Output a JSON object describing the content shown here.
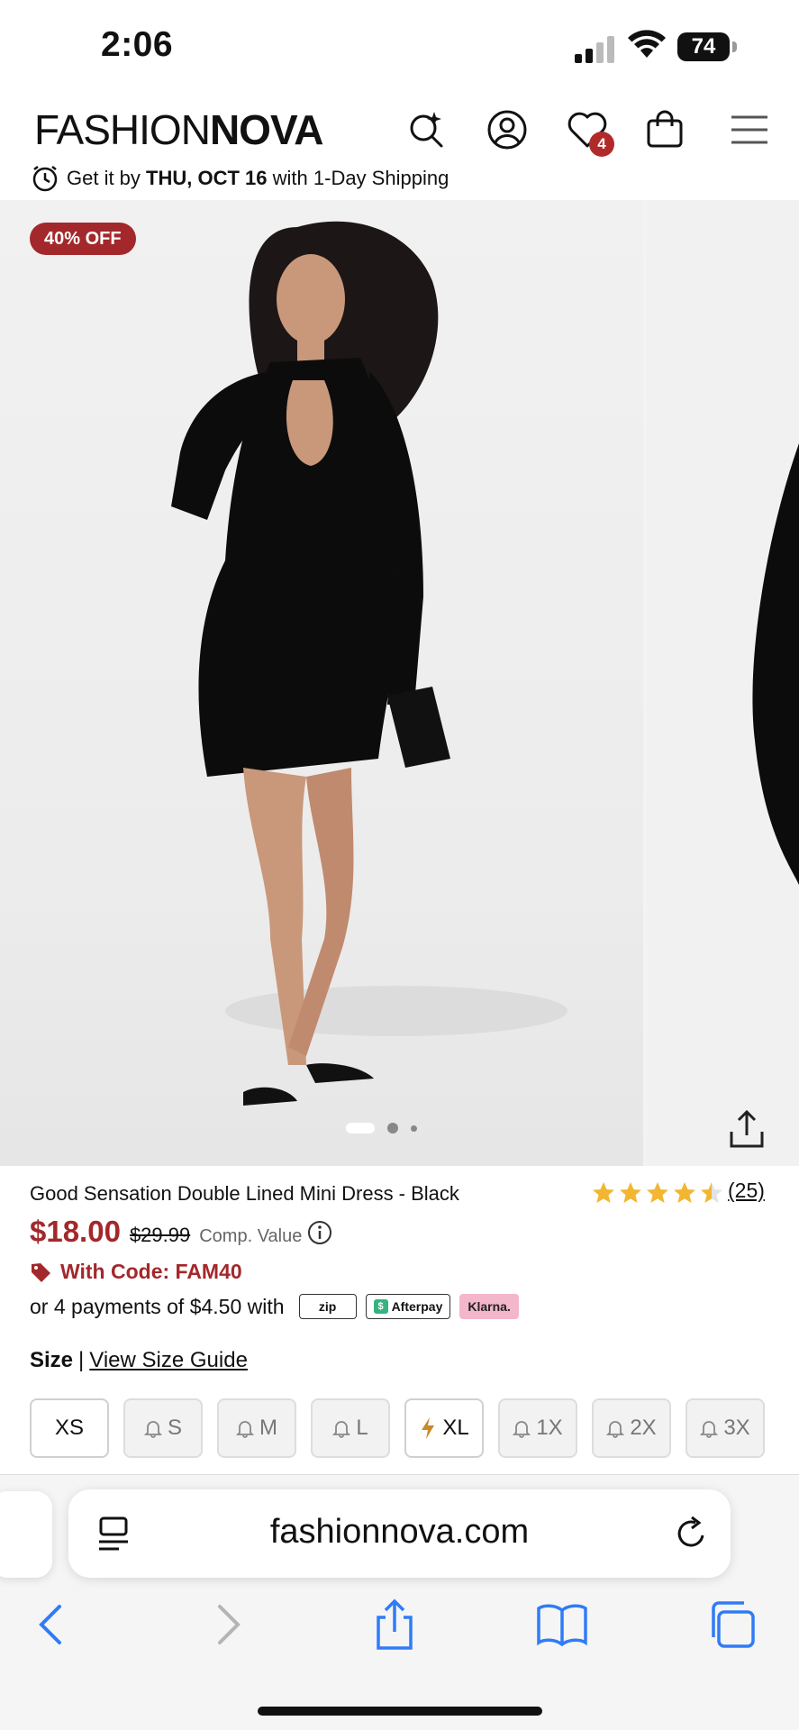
{
  "status_bar": {
    "time": "2:06",
    "battery": "74"
  },
  "header": {
    "logo_left": "FA",
    "logo_mid": "SHION",
    "logo_bold": "NOVA",
    "wishlist_count": "4"
  },
  "shipping": {
    "prefix": "Get it by",
    "date": "THU, OCT 16",
    "suffix": "with 1-Day Shipping"
  },
  "gallery": {
    "badge": "40% OFF"
  },
  "product": {
    "title": "Good Sensation Double Lined Mini Dress - Black",
    "rating": 4.5,
    "reviews": "(25)",
    "price": "$18.00",
    "compare_price": "$29.99",
    "comp_label": "Comp. Value",
    "code_text": "With Code: FAM40",
    "installments": "or 4 payments of $4.50 with",
    "pay_zip": "zip",
    "pay_afterpay": "Afterpay",
    "pay_klarna": "Klarna."
  },
  "size": {
    "label": "Size",
    "separator": "|",
    "guide": "View Size Guide",
    "options": [
      {
        "label": "XS",
        "state": "available"
      },
      {
        "label": "S",
        "state": "notify"
      },
      {
        "label": "M",
        "state": "notify"
      },
      {
        "label": "L",
        "state": "notify"
      },
      {
        "label": "XL",
        "state": "low-stock"
      },
      {
        "label": "1X",
        "state": "notify"
      },
      {
        "label": "2X",
        "state": "notify"
      },
      {
        "label": "3X",
        "state": "notify"
      }
    ]
  },
  "browser": {
    "url": "fashionnova.com"
  },
  "colors": {
    "accent": "#a3282b",
    "link_blue": "#2f7cf6"
  }
}
